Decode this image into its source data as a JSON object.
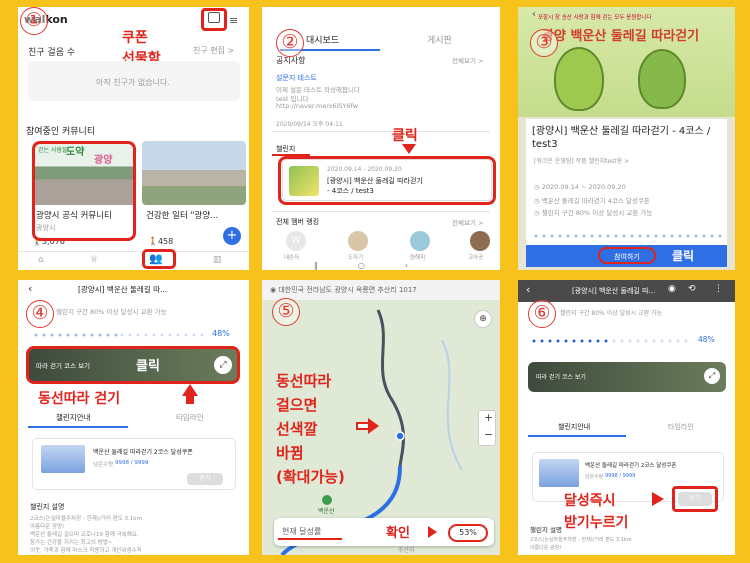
{
  "panel1": {
    "number": "①",
    "logo": "walkon",
    "friends_title": "친구 걸음 수",
    "friends_edit": "친구 편집 >",
    "friends_empty": "아직 친구가 없습니다.",
    "community_title": "참여중인 커뮤니티",
    "card1": {
      "banner_sub": "걷는 사람들",
      "banner_main": "도약",
      "banner_place": "광양",
      "title": "광양시 공식 커뮤니티",
      "sub": "광양시",
      "count": "3,076"
    },
    "card2": {
      "title": "건강한 일터 \"광양...",
      "count": "458"
    },
    "annot_coupon": "쿠폰",
    "annot_giftbox": "선물함"
  },
  "panel2": {
    "number": "②",
    "tab_dashboard": "대시보드",
    "tab_board": "게시판",
    "notice_title": "공지사항",
    "view_all": "전체보기 >",
    "notice_post_title": "설문지 테스트",
    "notice_body_1": "이제 설문 테스트 작성해봅니다",
    "notice_body_2": "test 입니다",
    "notice_link": "http://naver.me/x6lSY6fw",
    "notice_date": "2020/09/14 오후 04:11",
    "challenge_title": "챌린지",
    "challenge_dates": "2020.09.14 - 2020.09.20",
    "challenge_name_1": "[광양시] 백운산 둘레길 따라걷기",
    "challenge_name_2": "- 4코스 / test3",
    "ranking_title": "전체 멤버 랭킹",
    "ranking_all": "전체보기 >",
    "ranking_names": [
      "내손자",
      "도자기",
      "원해피",
      "고아공"
    ],
    "annot_click": "클릭"
  },
  "panel3": {
    "number": "③",
    "banner_top": "포항시 장 송산 사랑과 함께 걷는 모두 응원합니다",
    "banner_title": "광양 백운산 둘레길 따라걷기",
    "title": "[광양시] 백운산 둘레길 따라걷기 - 4코스 / test3",
    "host": "[워크온 운영팀] 작품 챌린지test용 >",
    "date_range": "2020.09.14 ~ 2020.09.20",
    "reward": "백운산 둘레길 따라걷기 4코스 달성쿠폰",
    "condition": "챌린지 구간 80% 이상 달성시 교환 가능",
    "join_button": "참여하기",
    "annot_click": "클릭"
  },
  "panel4": {
    "number": "④",
    "header": "[광양시] 백운산 둘레길 따...",
    "condition": "챌린지 구간 80% 이상 달성시 교환 가능",
    "percent": "48%",
    "percent_value": 48,
    "map_button": "따라 걷기 코스 보기",
    "annot_click": "클릭",
    "annot_follow": "동선따라 걷기",
    "tab_info": "챌린지안내",
    "tab_timeline": "타임라인",
    "coupon_title": "백운산 둘레길 따라걷기 2코스 달성쿠폰",
    "coupon_remain_label": "남은수량",
    "coupon_remain": "9998 / 9999",
    "receive_button": "받기",
    "desc_title": "챌린지 설명",
    "desc_lines": [
      "2코스(논실마을주차장 - 한재)/거리 편도 3.1km",
      "아름다운 광양!",
      "백운산 둘레길 걸으며 코로나19 함께 극복해요.",
      "참가는 건강을 지키는 최고의 방법~",
      "이웃, 가족과 함께 마스크 착용하고 개인위생수칙"
    ]
  },
  "panel5": {
    "number": "⑤",
    "location": "대한민국 전라남도 광양시 옥룡면 추산리 1017",
    "annot_lines": [
      "동선따라",
      "걸으면",
      "선색깔",
      "바뀜",
      "(확대가능)"
    ],
    "place_label": "백운산",
    "status_label": "현재 달성률",
    "annot_confirm": "확인",
    "percent": "53%",
    "road_label": "추산리",
    "zoom_in": "+",
    "zoom_out": "−"
  },
  "panel6": {
    "number": "⑥",
    "header": "[광양시] 백운산 둘레길 따...",
    "condition": "챌린지 구간 80% 이상 달성시 교환 가능",
    "percent": "48%",
    "map_button": "따라 걷기 코스 보기",
    "tab_info": "챌린지안내",
    "tab_timeline": "타임라인",
    "coupon_title": "백운산 둘레길 따라걷기 2코스 달성쿠폰",
    "coupon_remain_label": "남은수량",
    "coupon_remain": "9998 / 9999",
    "receive_button": "받기",
    "annot_lines": [
      "달성즉시",
      "받기누르기"
    ],
    "desc_title": "챌린지 설명",
    "desc_lines": [
      "2코스(논실마을주차장 - 한재)/거리 편도 3.1km",
      "아름다운 광양!"
    ]
  },
  "colors": {
    "frame": "#f6c21b",
    "annotation": "#e0241b",
    "accent_blue": "#2f6fe4",
    "progress": "#1d5fd8"
  }
}
